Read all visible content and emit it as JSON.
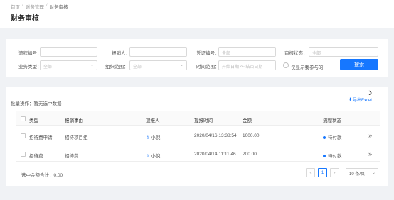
{
  "breadcrumb": [
    "首页",
    "财务管理",
    "财务审核"
  ],
  "page_title": "财务审核",
  "filters": {
    "flow_no_label": "流程编号：",
    "applicant_label": "报销人：",
    "voucher_label": "凭证编号：",
    "voucher_placeholder": "全部",
    "audit_status_label": "审核状态：",
    "audit_status_value": "全部",
    "biz_type_label": "业务类型：",
    "biz_type_value": "全部",
    "org_scope_label": "组织范围：",
    "org_scope_value": "全部",
    "time_range_label": "时间范围：",
    "time_start_placeholder": "开始日期",
    "time_end_placeholder": "结束日期",
    "time_sep": "～",
    "only_mine_label": "仅显示我参与的",
    "search_button": "搜索"
  },
  "batch": "批量操作：暂无选中数据",
  "export_label": "导出Excel",
  "table": {
    "columns": [
      "类型",
      "报销事由",
      "提报人",
      "提报时间",
      "金额",
      "流程状态"
    ],
    "rows": [
      {
        "type": "招待费申请",
        "reason": "招待项目组",
        "submitter": "小倪",
        "time": "2020/04/16 13:38:54",
        "amount": "1000.00",
        "status": "待付款"
      },
      {
        "type": "招待费",
        "reason": "招待费",
        "submitter": "小倪",
        "time": "2020/04/14 11:11:46",
        "amount": "200.00",
        "status": "待付款"
      }
    ]
  },
  "sum_label": "选中金额合计：0.00",
  "pagination": {
    "prev": "‹",
    "current": "1",
    "next": "›",
    "page_size": "10 条/页"
  },
  "colors": {
    "accent": "#1677ff",
    "bg": "#f0f2f5"
  }
}
